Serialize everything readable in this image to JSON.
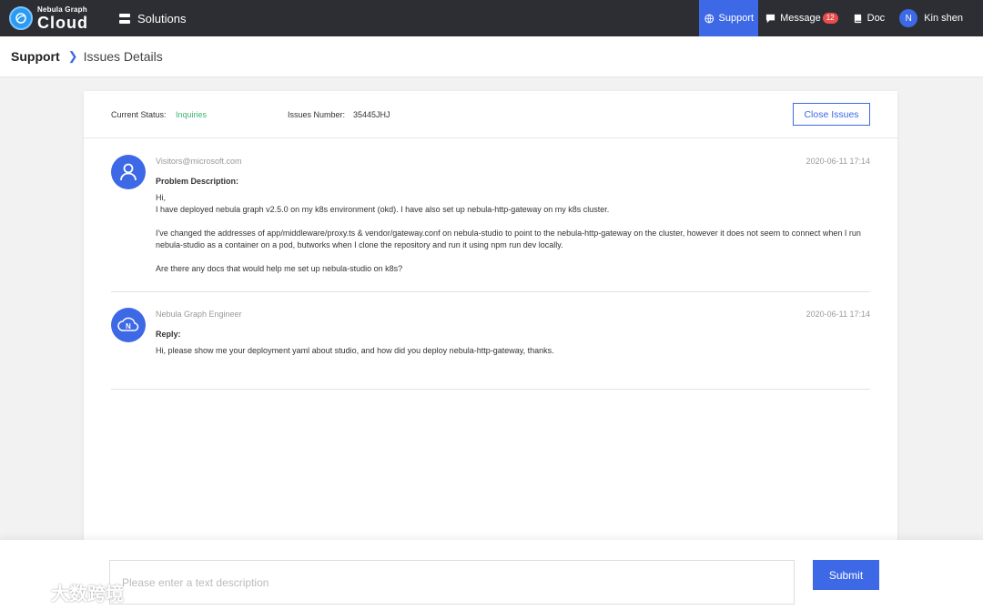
{
  "brand": {
    "sub": "Nebula Graph",
    "main": "Cloud",
    "accent": "#3d68e6"
  },
  "nav": {
    "solutions": "Solutions",
    "support": "Support",
    "message": "Message",
    "message_count": "12",
    "doc": "Doc",
    "user_initial": "N",
    "user_name": "Kin shen"
  },
  "breadcrumb": {
    "root": "Support",
    "current": "Issues Details"
  },
  "issue": {
    "status_label": "Current Status:",
    "status_value": "Inquiries",
    "status_color": "#3bb46e",
    "number_label": "Issues Number:",
    "number_value": "35445JHJ",
    "close_button": "Close Issues"
  },
  "messages": [
    {
      "user": "Visitors@microsoft.com",
      "time": "2020-06-11 17:14",
      "title": "Problem Description:",
      "lines": [
        "Hi,",
        "I have deployed nebula graph v2.5.0 on my k8s environment (okd). I have also set up nebula-http-gateway on my k8s cluster.",
        "I've changed the addresses of app/middleware/proxy.ts & vendor/gateway.conf on nebula-studio to point to the nebula-http-gateway on the cluster, however it does not seem to connect when I run nebula-studio as a container on a pod, butworks when I clone the repository and run it using npm run dev locally.",
        "Are there any docs that would help me set up nebula-studio on k8s?"
      ]
    },
    {
      "user": "Nebula Graph Engineer",
      "time": "2020-06-11 17:14",
      "title": "Reply:",
      "lines": [
        "Hi, please show me your deployment yaml about studio, and how did you deploy nebula-http-gateway, thanks."
      ]
    }
  ],
  "composer": {
    "placeholder": "Please enter a text description",
    "submit": "Submit"
  },
  "watermark": {
    "text": "大数跨境"
  }
}
